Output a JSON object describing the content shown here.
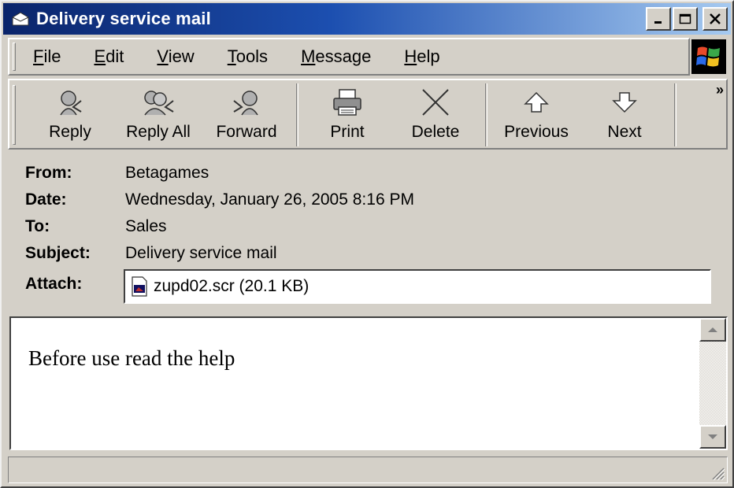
{
  "window": {
    "title": "Delivery service mail",
    "title_icon": "mail-envelope-icon",
    "controls": [
      "minimize-icon",
      "maximize-icon",
      "close-icon"
    ]
  },
  "menu": {
    "items": [
      {
        "label": "File",
        "accel": "F"
      },
      {
        "label": "Edit",
        "accel": "E"
      },
      {
        "label": "View",
        "accel": "V"
      },
      {
        "label": "Tools",
        "accel": "T"
      },
      {
        "label": "Message",
        "accel": "M"
      },
      {
        "label": "Help",
        "accel": "H"
      }
    ]
  },
  "toolbar": {
    "reply": "Reply",
    "reply_all": "Reply All",
    "forward": "Forward",
    "print": "Print",
    "delete": "Delete",
    "previous": "Previous",
    "next": "Next",
    "overflow": "»"
  },
  "header": {
    "from_label": "From:",
    "from_value": "Betagames",
    "date_label": "Date:",
    "date_value": "Wednesday, January 26, 2005 8:16 PM",
    "to_label": "To:",
    "to_value": "Sales",
    "subject_label": "Subject:",
    "subject_value": "Delivery service mail",
    "attach_label": "Attach:",
    "attachment": "zupd02.scr (20.1 KB)"
  },
  "body": {
    "text": "Before use read the help"
  },
  "colors": {
    "titlebar_start": "#0a246a",
    "titlebar_end": "#a6caf0",
    "face": "#d4d0c8"
  }
}
